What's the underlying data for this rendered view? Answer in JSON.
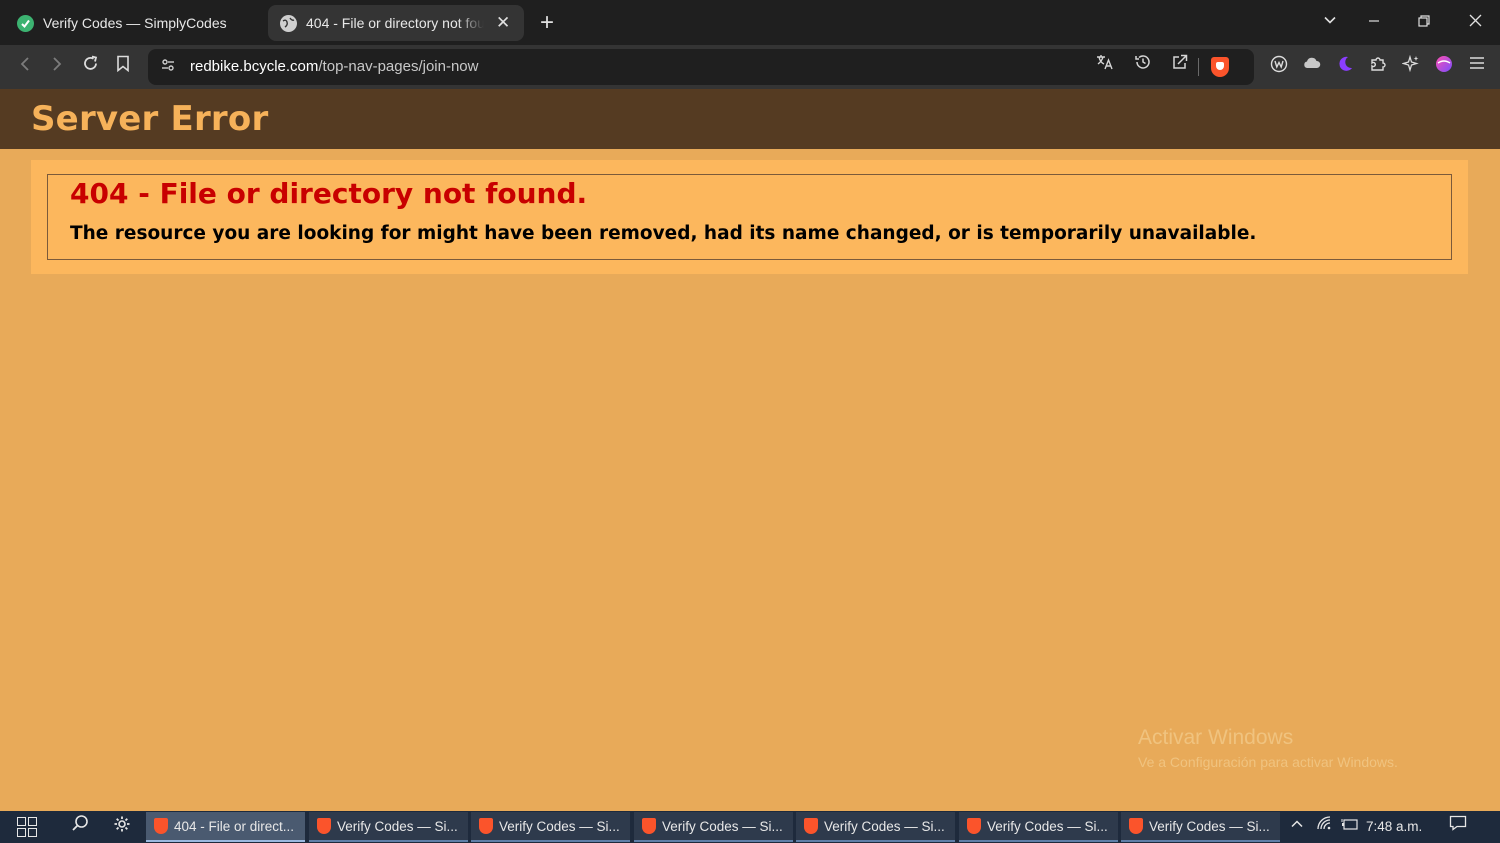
{
  "browser": {
    "tabs": [
      {
        "title": "Verify Codes — SimplyCodes",
        "active": false,
        "favicon": "simplycodes-icon"
      },
      {
        "title": "404 - File or directory not found.",
        "active": true,
        "favicon": "globe-icon"
      }
    ],
    "new_tab": "+",
    "address_bar": {
      "host": "redbike.bcycle.com",
      "path": "/top-nav-pages/join-now"
    }
  },
  "page": {
    "header_title": "Server Error",
    "error_heading": "404 - File or directory not found.",
    "error_message": "The resource you are looking for might have been removed, had its name changed, or is temporarily unavailable.",
    "colors": {
      "header_bg": "#553b22",
      "header_text": "#f6b25a",
      "page_bg": "#e8aa59",
      "content_bg": "#fcb75d",
      "error_heading": "#c80000"
    }
  },
  "watermark": {
    "title": "Activar Windows",
    "subtitle": "Ve a Configuración para activar Windows."
  },
  "taskbar": {
    "tasks": [
      {
        "label": "404 - File or direct...",
        "active": true
      },
      {
        "label": "Verify Codes — Si...",
        "active": false
      },
      {
        "label": "Verify Codes — Si...",
        "active": false
      },
      {
        "label": "Verify Codes — Si...",
        "active": false
      },
      {
        "label": "Verify Codes — Si...",
        "active": false
      },
      {
        "label": "Verify Codes — Si...",
        "active": false
      },
      {
        "label": "Verify Codes — Si...",
        "active": false
      }
    ],
    "clock": "7:48 a.m."
  }
}
